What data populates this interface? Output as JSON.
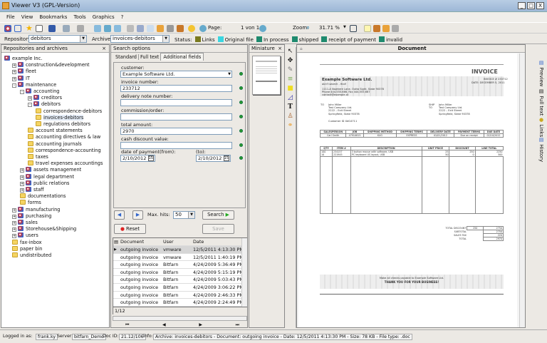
{
  "window": {
    "title": "Viewer V3 (GPL-Version)",
    "minimize": "_",
    "maximize": "□",
    "close": "X"
  },
  "menu": [
    "File",
    "View",
    "Bookmarks",
    "Tools",
    "Graphics",
    "?"
  ],
  "toolbar": {
    "page_label": "Page:",
    "page_value": "1 von 1",
    "zoom_label": "Zoom:",
    "zoom_value": "31.71 %"
  },
  "repobar": {
    "repository_label": "Repository:",
    "repository_value": "debitors",
    "archive_label": "Archive:",
    "archive_value": "invoices-debitors",
    "status_label": "Status:",
    "statuses": [
      {
        "label": "Links",
        "color": "#7a7a1e"
      },
      {
        "label": "Original file",
        "color": "#3ad6e0"
      },
      {
        "label": "In process",
        "color": "#1e8a6e"
      },
      {
        "label": "shipped",
        "color": "#1e8a6e"
      },
      {
        "label": "receipt of payment",
        "color": "#1e8a6e"
      },
      {
        "label": "invalid",
        "color": "#1e8a6e"
      }
    ]
  },
  "tree": {
    "title": "Repositories and archives",
    "close": "×",
    "items": [
      {
        "label": "example Inc.",
        "level": 0,
        "type": "repo",
        "pm": ""
      },
      {
        "label": "construction&development",
        "level": 1,
        "type": "repo",
        "pm": "+"
      },
      {
        "label": "fleet",
        "level": 1,
        "type": "repo",
        "pm": "+"
      },
      {
        "label": "IT",
        "level": 1,
        "type": "repo",
        "pm": "+"
      },
      {
        "label": "maintenance",
        "level": 1,
        "type": "repo",
        "pm": "-"
      },
      {
        "label": "accounting",
        "level": 2,
        "type": "repo",
        "pm": "-"
      },
      {
        "label": "creditors",
        "level": 3,
        "type": "repo",
        "pm": "+"
      },
      {
        "label": "debitors",
        "level": 3,
        "type": "repo",
        "pm": "-"
      },
      {
        "label": "correspondence-debitors",
        "level": 4,
        "type": "folder",
        "pm": ""
      },
      {
        "label": "invoices-debitors",
        "level": 4,
        "type": "folder",
        "pm": ""
      },
      {
        "label": "regulations debitors",
        "level": 4,
        "type": "folder",
        "pm": ""
      },
      {
        "label": "account statements",
        "level": 3,
        "type": "folder",
        "pm": ""
      },
      {
        "label": "accounting directives & law",
        "level": 3,
        "type": "folder",
        "pm": ""
      },
      {
        "label": "accounting journals",
        "level": 3,
        "type": "folder",
        "pm": ""
      },
      {
        "label": "correspondence-accounting",
        "level": 3,
        "type": "folder",
        "pm": ""
      },
      {
        "label": "taxes",
        "level": 3,
        "type": "folder",
        "pm": ""
      },
      {
        "label": "travel expenses accountings",
        "level": 3,
        "type": "folder",
        "pm": ""
      },
      {
        "label": "assets management",
        "level": 2,
        "type": "repo",
        "pm": "+"
      },
      {
        "label": "legal department",
        "level": 2,
        "type": "repo",
        "pm": "+"
      },
      {
        "label": "public relations",
        "level": 2,
        "type": "repo",
        "pm": "+"
      },
      {
        "label": "staff",
        "level": 2,
        "type": "repo",
        "pm": "+"
      },
      {
        "label": "documentations",
        "level": 2,
        "type": "folder",
        "pm": ""
      },
      {
        "label": "forms",
        "level": 2,
        "type": "folder",
        "pm": ""
      },
      {
        "label": "manufacturing",
        "level": 1,
        "type": "repo",
        "pm": "+"
      },
      {
        "label": "purchasing",
        "level": 1,
        "type": "repo",
        "pm": "+"
      },
      {
        "label": "sales",
        "level": 1,
        "type": "repo",
        "pm": "+"
      },
      {
        "label": "Storehouse&Shipping",
        "level": 1,
        "type": "repo",
        "pm": "+"
      },
      {
        "label": "users",
        "level": 1,
        "type": "repo",
        "pm": "+"
      },
      {
        "label": "fax-inbox",
        "level": 1,
        "type": "folder",
        "pm": ""
      },
      {
        "label": "paper bin",
        "level": 1,
        "type": "folder",
        "pm": ""
      },
      {
        "label": "undistributed",
        "level": 1,
        "type": "folder",
        "pm": ""
      }
    ]
  },
  "search": {
    "title": "Search options",
    "tabs": [
      "Standard",
      "Full text",
      "Additional fields"
    ],
    "fields": [
      {
        "label": "customer:",
        "value": "Example Software Ltd.",
        "dropdown": true
      },
      {
        "label": "invoice number:",
        "value": "233712"
      },
      {
        "label": "delivery note number:",
        "value": ""
      },
      {
        "label": "commission/order:",
        "value": ""
      },
      {
        "label": "total amount:",
        "value": "2970"
      },
      {
        "label": "cash discount value:",
        "value": ""
      }
    ],
    "date_from_label": "date of payment(from):",
    "date_from": "2/10/2012",
    "date_to_label": "(to):",
    "date_to": "2/10/2012",
    "max_hits_label": "Max. hits:",
    "max_hits": "50",
    "search_button": "Search",
    "reset_button": "Reset",
    "save_button": "Save"
  },
  "results": {
    "columns": [
      "Document",
      "User",
      "Date"
    ],
    "rows": [
      [
        "outgoing invoice",
        "vmware",
        "12/5/2011 4:13:30 PM"
      ],
      [
        "outgoing invoice",
        "vmware",
        "12/5/2011 1:40:19 PM"
      ],
      [
        "outgoing invoice",
        "Bitfarn",
        "4/24/2009 5:36:49 PM"
      ],
      [
        "outgoing invoice",
        "Bitfarn",
        "4/24/2009 5:15:19 PM"
      ],
      [
        "outgoing invoice",
        "Bitfarn",
        "4/24/2009 5:03:43 PM"
      ],
      [
        "outgoing invoice",
        "Bitfarn",
        "4/24/2009 3:06:22 PM"
      ],
      [
        "outgoing invoice",
        "Bitfarn",
        "4/24/2009 2:46:33 PM"
      ],
      [
        "outgoing invoice",
        "Bitfarn",
        "4/24/2009 2:24:49 PM"
      ]
    ],
    "page": "1/12"
  },
  "miniature": {
    "title": "Miniature",
    "close": "×"
  },
  "document": {
    "title": "Document",
    "invoice": {
      "heading": "INVOICE",
      "company": "Example Software Ltd.",
      "slogan": "don't search - find!",
      "number": "INVOICE # 233712",
      "date": "DATE: DECEMBER 5, 2011",
      "address1": "1111-A Nowhere Lane, Outta Sight, State 90378",
      "address2": "Phone 444.555.666, Fax 444.555.667",
      "email": "contact@example.xt",
      "to_label": "TO",
      "ship_label": "SHIP TO",
      "to": [
        "John Miller",
        "Test Company Ltd.",
        "2222 – Exit Street",
        "Springfield, State 90378"
      ],
      "customer_id": "Customer ID XdG4711",
      "meta_headers": [
        "SALESPERSON",
        "JOB",
        "SHIPPING METHOD",
        "SHIPPING TERMS",
        "DELIVERY DATE",
        "PAYMENT TERMS",
        "DUE DATE"
      ],
      "meta_values": [
        "Carl Smith",
        "47910815",
        "KUG",
        "EXPRESS",
        "02/01/2012",
        "Due on receipt",
        "02/10/2012"
      ],
      "item_headers": [
        "QTY",
        "ITEM #",
        "DESCRIPTION",
        "UNIT PRICE",
        "DISCOUNT",
        "LINE TOTAL"
      ],
      "items": [
        [
          "100",
          "234157",
          "3 button mouse with software, USB",
          "25",
          "250",
          "2250"
        ],
        [
          "10",
          "221945",
          "PC keyboard US layout, USB",
          "50",
          "0",
          "500"
        ]
      ],
      "totals": [
        [
          "TOTAL DISCOUNT",
          "250",
          "2750"
        ],
        [
          "SUBTOTAL",
          "",
          "2750"
        ],
        [
          "SALES TAX",
          "",
          "220"
        ],
        [
          "TOTAL",
          "",
          "2970"
        ]
      ],
      "footer1": "Make all checks payable to Example Software Ltd.",
      "footer2": "THANK YOU FOR YOUR BUSINESS!"
    }
  },
  "side_tabs": [
    "Preview",
    "Full text",
    "Links",
    "History"
  ],
  "status": {
    "logged_label": "Logged in as:",
    "user": "frank.ky",
    "server_label": "Server:",
    "server": "bitfarn_Demo",
    "docid_label": "Doc ID:",
    "docid": "21.12/106",
    "info_label": "Info:",
    "info": "Archive: invoices-debitors - Document: outgoing invoice - Date: 12/5/2011 4:13:30 PM - Size: 78 KB - File type: .doc"
  }
}
